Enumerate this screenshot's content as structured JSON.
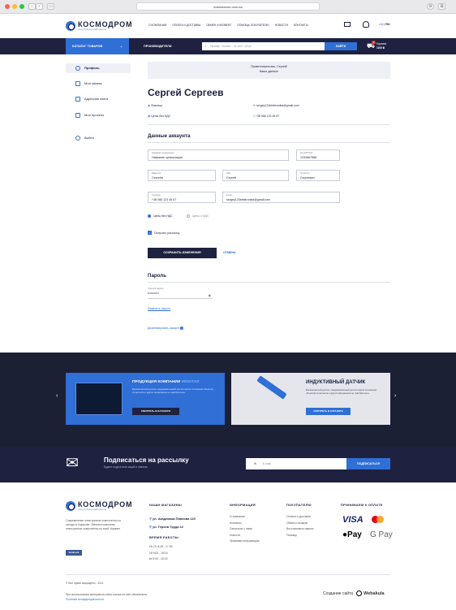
{
  "browser": {
    "url": "kosmodrom.com.ua"
  },
  "header": {
    "logo_name": "КОСМОДРОМ",
    "logo_sub": "электронные компоненты",
    "nav": [
      "О КОМПАНИИ",
      "ОПЛАТА И ДОСТАВКА",
      "ОБМЕН И ВОЗВРАТ",
      "ПОМОЩЬ ПОКУПАТЕЛЮ",
      "НОВОСТИ",
      "КОНТАКТЫ"
    ],
    "lang_ua": "UA",
    "lang_ru": "RU"
  },
  "navbar": {
    "catalog": "КАТАЛОГ ТОВАРОВ",
    "producers": "ПРОИЗВОДИТЕЛИ",
    "search_placeholder": "Пример: Murata + 15-1007-101pf",
    "search_button": "НАЙТИ",
    "cart_label": "Корзина",
    "cart_total": "1100 ₴",
    "cart_count": "2"
  },
  "sidebar": {
    "items": [
      {
        "label": "Профиль"
      },
      {
        "label": "Мои заказы"
      },
      {
        "label": "Адресная книга"
      },
      {
        "label": "Мои проекты"
      },
      {
        "label": "Выйти"
      }
    ]
  },
  "welcome": {
    "line1": "Приветствуем вас, Сергей!",
    "line2": "Ваши данные"
  },
  "profile": {
    "name": "Сергей Сергеев",
    "type": "Физлицо",
    "price_type": "Цены без НДС",
    "email": "sergey123elektronika@gmail.com",
    "phone": "+38 066 123 45 67"
  },
  "account": {
    "title": "Данные аккаунта",
    "org_label": "Название организации",
    "org_value": "Название организации",
    "edrpou_label": "Код ЕГРПОУ",
    "edrpou_value": "1234567888",
    "surname_label": "Фамилия",
    "surname_value": "Сергеев",
    "name_label": "Имя",
    "name_value": "Сергей",
    "patronymic_label": "Отчество",
    "patronymic_value": "Сергеевич",
    "phone_label": "Телефон",
    "phone_value": "+38 066 123 45 67",
    "email_label": "Email",
    "email_value": "sergey123elektronika@gmail.com",
    "radio_no_vat": "Цены без НДС",
    "radio_vat": "Цены с НДС",
    "newsletter": "Получать рассылку",
    "save_button": "СОХРАНИТЬ ИЗМЕНЕНИЯ",
    "cancel_button": "ОТМЕНА"
  },
  "password": {
    "title": "Пароль",
    "current_label": "Текущий пароль",
    "current_value": "•••••••••••",
    "change_link": "Изменить пароль",
    "deactivate_link": "Деактивировать аккаунт"
  },
  "banners": {
    "left_title_1": "ПРОДУКЦИЯ КОМПАНИИ",
    "left_title_2": "WINSTAR",
    "left_text": "Бесконтактный датчик, предназначенный для контроля положения объектов из металла и других материалов не чувствителен.",
    "left_button": "СМОТРЕТЬ В КАТАЛОГЕ",
    "right_title": "ИНДУКТИВНЫЙ ДАТЧИК",
    "right_text": "Бесконтактный датчик, предназначенный для контроля положения объектов из металла и других материалов не чувствителен.",
    "right_button": "СМОТРЕТЬ В КАТАЛОГЕ"
  },
  "subscribe": {
    "title": "Подписаться на рассылку",
    "subtitle": "Будьте в курсе всех акций и новинок",
    "email_placeholder": "E-mail",
    "button": "ПОДПИСАТЬСЯ"
  },
  "footer": {
    "about": "Современные электронные компоненты со склада в Харькове. Магазин компания электронные компоненты по всей Украине",
    "facebook": "facebook",
    "stores_title": "НАШИ МАГАЗИНЫ",
    "store1": "ул. Академика Павлова 120",
    "store2": "ул. Героев Труда 12",
    "hours_title": "ВРЕМЯ РАБОТЫ:",
    "hours1": "Пн-Пт 8:45 - 17:30",
    "hours2": "сб 9:00 - 15:15",
    "hours3": "вс 9:00 - 15:15",
    "info_title": "ИНФОРМАЦИЯ",
    "info_links": [
      "О компании",
      "Контакты",
      "Связаться с нами",
      "Новости",
      "Правовая информация"
    ],
    "buyers_title": "ПОКУПАТЕЛЮ",
    "buyers_links": [
      "Оплата и доставка",
      "Обмен и возврат",
      "Восстановить пароль",
      "Помощь"
    ],
    "pay_title": "ПРИНИМАЕМ К ОПЛАТЕ",
    "visa": "VISA",
    "apple_pay": "Pay",
    "google_pay": "G Pay",
    "copyright": "© Все права защищены - 2021",
    "legal1": "При использовании материалов сайта ссылка на сайт обязательна",
    "legal2": "Политика конфиденциальности",
    "made_by": "Создание сайта",
    "studio": "Webakula"
  }
}
